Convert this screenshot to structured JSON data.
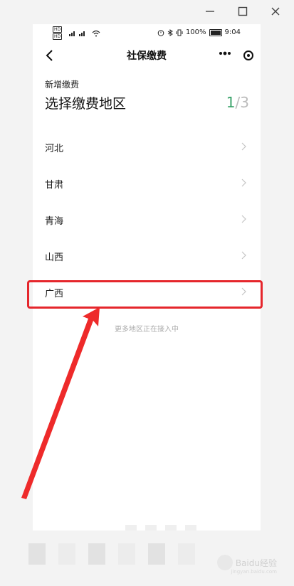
{
  "window_controls": {
    "minimize": "—",
    "maximize": "☐",
    "close": "✕"
  },
  "statusbar": {
    "hd1": "HD",
    "hd2": "HD",
    "signal1": "⁴⁶.ıll",
    "signal2": "⁴⁶.ıll",
    "battery_pct": "100%",
    "time": "9:04"
  },
  "navbar": {
    "title": "社保缴费"
  },
  "header": {
    "subtitle": "新增缴费",
    "title": "选择缴费地区",
    "step_current": "1",
    "step_sep": "/",
    "step_total": "3"
  },
  "regions": [
    {
      "label": "河北"
    },
    {
      "label": "甘肃"
    },
    {
      "label": "青海"
    },
    {
      "label": "山西"
    },
    {
      "label": "广西"
    }
  ],
  "more_text": "更多地区正在接入中",
  "watermark": {
    "text": "Baidu经验",
    "sub": "jingyan.baidu.com"
  },
  "colors": {
    "accent_green": "#3aa36a",
    "highlight_red": "#e5262c"
  }
}
